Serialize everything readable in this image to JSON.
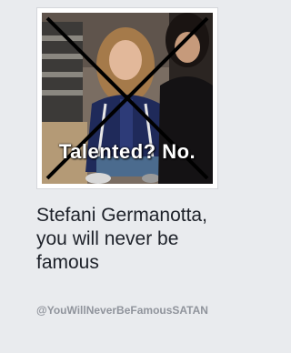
{
  "profile": {
    "photo_caption": "Talented? No.",
    "page_name": "Stefani Germanotta, you will never be famous",
    "handle": "@YouWillNeverBeFamousSATAN"
  }
}
